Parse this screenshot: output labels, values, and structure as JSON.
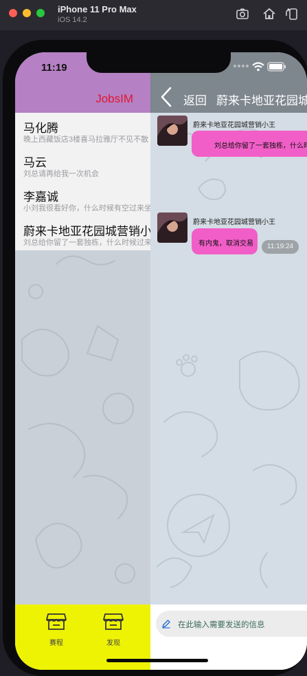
{
  "simulator": {
    "device_name": "iPhone 11 Pro Max",
    "os_version": "iOS 14.2",
    "icons": [
      "screenshot-icon",
      "home-icon",
      "rotate-icon"
    ]
  },
  "status_bar": {
    "time": "11:19"
  },
  "left_panel": {
    "app_title": "JobsIM",
    "title_color": "#e0182e",
    "header_color": "#b580c4",
    "conversations": [
      {
        "name": "马化腾",
        "preview": "晚上西藏饭店3楼喜马拉雅厅不见不散"
      },
      {
        "name": "马云",
        "preview": "刘总请再给我一次机会"
      },
      {
        "name": "李嘉诚",
        "preview": "小刘我很看好你，什么时候有空过来坐坐"
      },
      {
        "name": "蔚来卡地亚花园城营销小王",
        "preview": "刘总给你留了一套独栋，什么时候过来看看"
      }
    ],
    "tabs": [
      {
        "label": "赛程",
        "icon": "shop-icon"
      },
      {
        "label": "发现",
        "icon": "shop-icon"
      }
    ],
    "tabbar_color": "#eef304"
  },
  "chat": {
    "back_label": "返回",
    "title": "蔚来卡地亚花园城营销小王",
    "messages": [
      {
        "sender": "蔚来卡地亚花园城营销小王",
        "text": "刘总给你留了一套独栋，什么时候过来看看",
        "time": ""
      },
      {
        "sender": "蔚来卡地亚花园城营销小王",
        "text": "有内鬼，取消交易",
        "time": "11:19:24"
      }
    ],
    "bubble_color": "#f25ec8",
    "input_placeholder": "在此输入需要发送的信息"
  }
}
